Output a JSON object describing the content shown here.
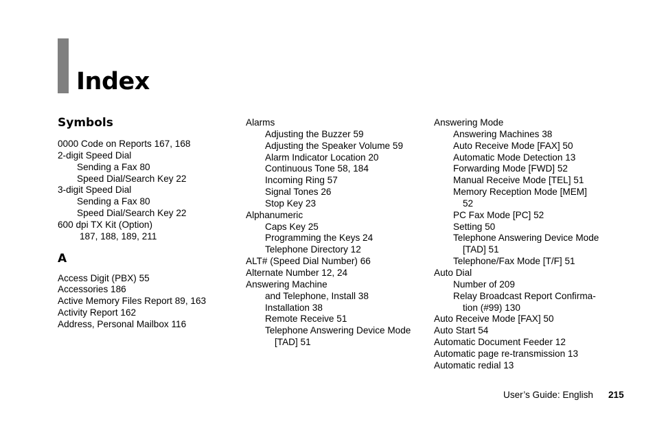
{
  "page": {
    "title": "Index",
    "footer": {
      "guide": "User’s Guide:  English",
      "page_number": "215"
    }
  },
  "col1": {
    "symbols_heading": "Symbols",
    "symbols": [
      {
        "level": 0,
        "text": "0000 Code on Reports   167,  168"
      },
      {
        "level": 0,
        "text": "2-digit Speed Dial"
      },
      {
        "level": 1,
        "text": "Sending a Fax  80"
      },
      {
        "level": 1,
        "text": "Speed Dial/Search Key  22"
      },
      {
        "level": 0,
        "text": "3-digit Speed Dial"
      },
      {
        "level": 1,
        "text": "Sending a Fax  80"
      },
      {
        "level": 1,
        "text": "Speed Dial/Search Key  22"
      },
      {
        "level": 0,
        "text": "600 dpi TX Kit (Option)"
      },
      {
        "level": "c0",
        "text": "187,  188,  189,  211"
      }
    ],
    "a_heading": "A",
    "a_entries": [
      {
        "level": 0,
        "text": "Access Digit (PBX)  55"
      },
      {
        "level": 0,
        "text": "Accessories  186"
      },
      {
        "level": 0,
        "text": "Active Memory Files Report  89,  163"
      },
      {
        "level": 0,
        "text": "Activity Report  162"
      },
      {
        "level": 0,
        "text": "Address, Personal Mailbox  116"
      }
    ]
  },
  "col2": [
    {
      "level": 0,
      "text": "Alarms"
    },
    {
      "level": 1,
      "text": "Adjusting the Buzzer  59"
    },
    {
      "level": 1,
      "text": "Adjusting the Speaker Volume  59"
    },
    {
      "level": 1,
      "text": "Alarm Indicator Location  20"
    },
    {
      "level": 1,
      "text": "Continuous Tone  58,  184"
    },
    {
      "level": 1,
      "text": "Incoming Ring  57"
    },
    {
      "level": 1,
      "text": "Signal Tones  26"
    },
    {
      "level": 1,
      "text": "Stop Key  23"
    },
    {
      "level": 0,
      "text": "Alphanumeric"
    },
    {
      "level": 1,
      "text": "Caps Key  25"
    },
    {
      "level": 1,
      "text": "Programming the Keys  24"
    },
    {
      "level": 1,
      "text": "Telephone Directory  12"
    },
    {
      "level": 0,
      "text": "ALT# (Speed Dial Number)  66"
    },
    {
      "level": 0,
      "text": "Alternate Number  12,  24"
    },
    {
      "level": 0,
      "text": "Answering Machine"
    },
    {
      "level": 1,
      "text": "and Telephone, Install  38"
    },
    {
      "level": 1,
      "text": "Installation  38"
    },
    {
      "level": 1,
      "text": "Remote Receive  51"
    },
    {
      "level": 1,
      "text": "Telephone Answering Device Mode"
    },
    {
      "level": "c1",
      "text": "[TAD]  51"
    }
  ],
  "col3": [
    {
      "level": 0,
      "text": "Answering Mode"
    },
    {
      "level": 1,
      "text": "Answering Machines  38"
    },
    {
      "level": 1,
      "text": "Auto Receive Mode [FAX]  50"
    },
    {
      "level": 1,
      "text": "Automatic Mode Detection  13"
    },
    {
      "level": 1,
      "text": "Forwarding Mode [FWD]  52"
    },
    {
      "level": 1,
      "text": "Manual Receive Mode [TEL]  51"
    },
    {
      "level": 1,
      "text": "Memory Reception Mode [MEM]"
    },
    {
      "level": "c1",
      "text": "52"
    },
    {
      "level": 1,
      "text": "PC Fax Mode [PC]  52"
    },
    {
      "level": 1,
      "text": "Setting  50"
    },
    {
      "level": 1,
      "text": "Telephone Answering Device Mode"
    },
    {
      "level": "c1",
      "text": "[TAD]  51"
    },
    {
      "level": 1,
      "text": "Telephone/Fax Mode [T/F]  51"
    },
    {
      "level": 0,
      "text": "Auto Dial"
    },
    {
      "level": 1,
      "text": "Number of  209"
    },
    {
      "level": 1,
      "text": "Relay Broadcast Report Confirma-"
    },
    {
      "level": "c1",
      "text": "tion (#99)  130"
    },
    {
      "level": 0,
      "text": "Auto Receive Mode [FAX]  50"
    },
    {
      "level": 0,
      "text": "Auto Start  54"
    },
    {
      "level": 0,
      "text": "Automatic Document Feeder  12"
    },
    {
      "level": 0,
      "text": "Automatic page re-transmission  13"
    },
    {
      "level": 0,
      "text": "Automatic redial  13"
    }
  ]
}
